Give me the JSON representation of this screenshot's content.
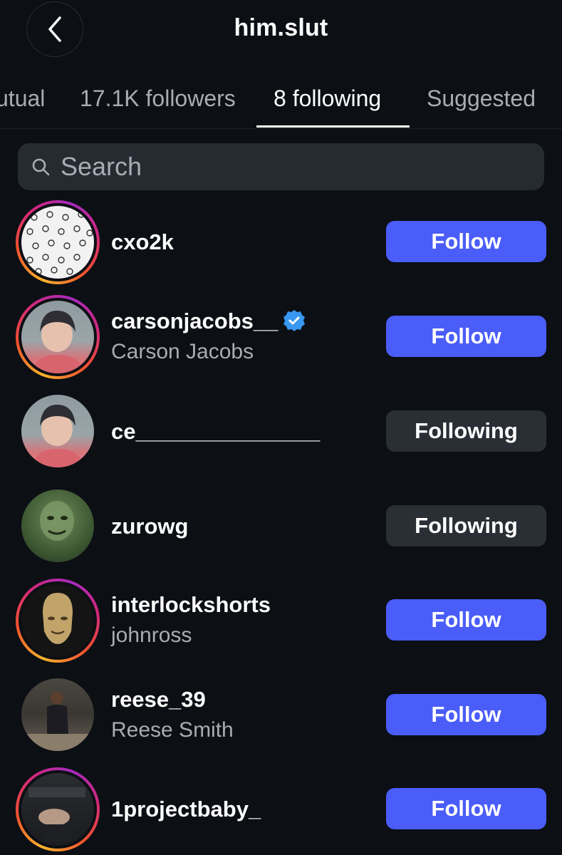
{
  "header": {
    "title": "him.slut"
  },
  "tabs": [
    {
      "label": "utual"
    },
    {
      "label": "17.1K followers"
    },
    {
      "label": "8 following"
    },
    {
      "label": "Suggested"
    }
  ],
  "search": {
    "placeholder": "Search"
  },
  "users": [
    {
      "username": "cxo2k",
      "full_name": "",
      "button": "Follow",
      "verified": false,
      "story_ring": true
    },
    {
      "username": "carsonjacobs__",
      "full_name": "Carson Jacobs",
      "button": "Follow",
      "verified": true,
      "story_ring": true
    },
    {
      "username": "ce_______________",
      "full_name": "",
      "button": "Following",
      "verified": false,
      "story_ring": false
    },
    {
      "username": "zurowg",
      "full_name": "",
      "button": "Following",
      "verified": false,
      "story_ring": false
    },
    {
      "username": "interlockshorts",
      "full_name": "johnross",
      "button": "Follow",
      "verified": false,
      "story_ring": true
    },
    {
      "username": "reese_39",
      "full_name": "Reese Smith",
      "button": "Follow",
      "verified": false,
      "story_ring": false
    },
    {
      "username": "1projectbaby_",
      "full_name": "",
      "button": "Follow",
      "verified": false,
      "story_ring": true
    }
  ],
  "colors": {
    "follow_button": "#4a5df9",
    "following_button": "#2a2e35",
    "background": "#0c0f14",
    "verified_badge": "#3897f0"
  }
}
